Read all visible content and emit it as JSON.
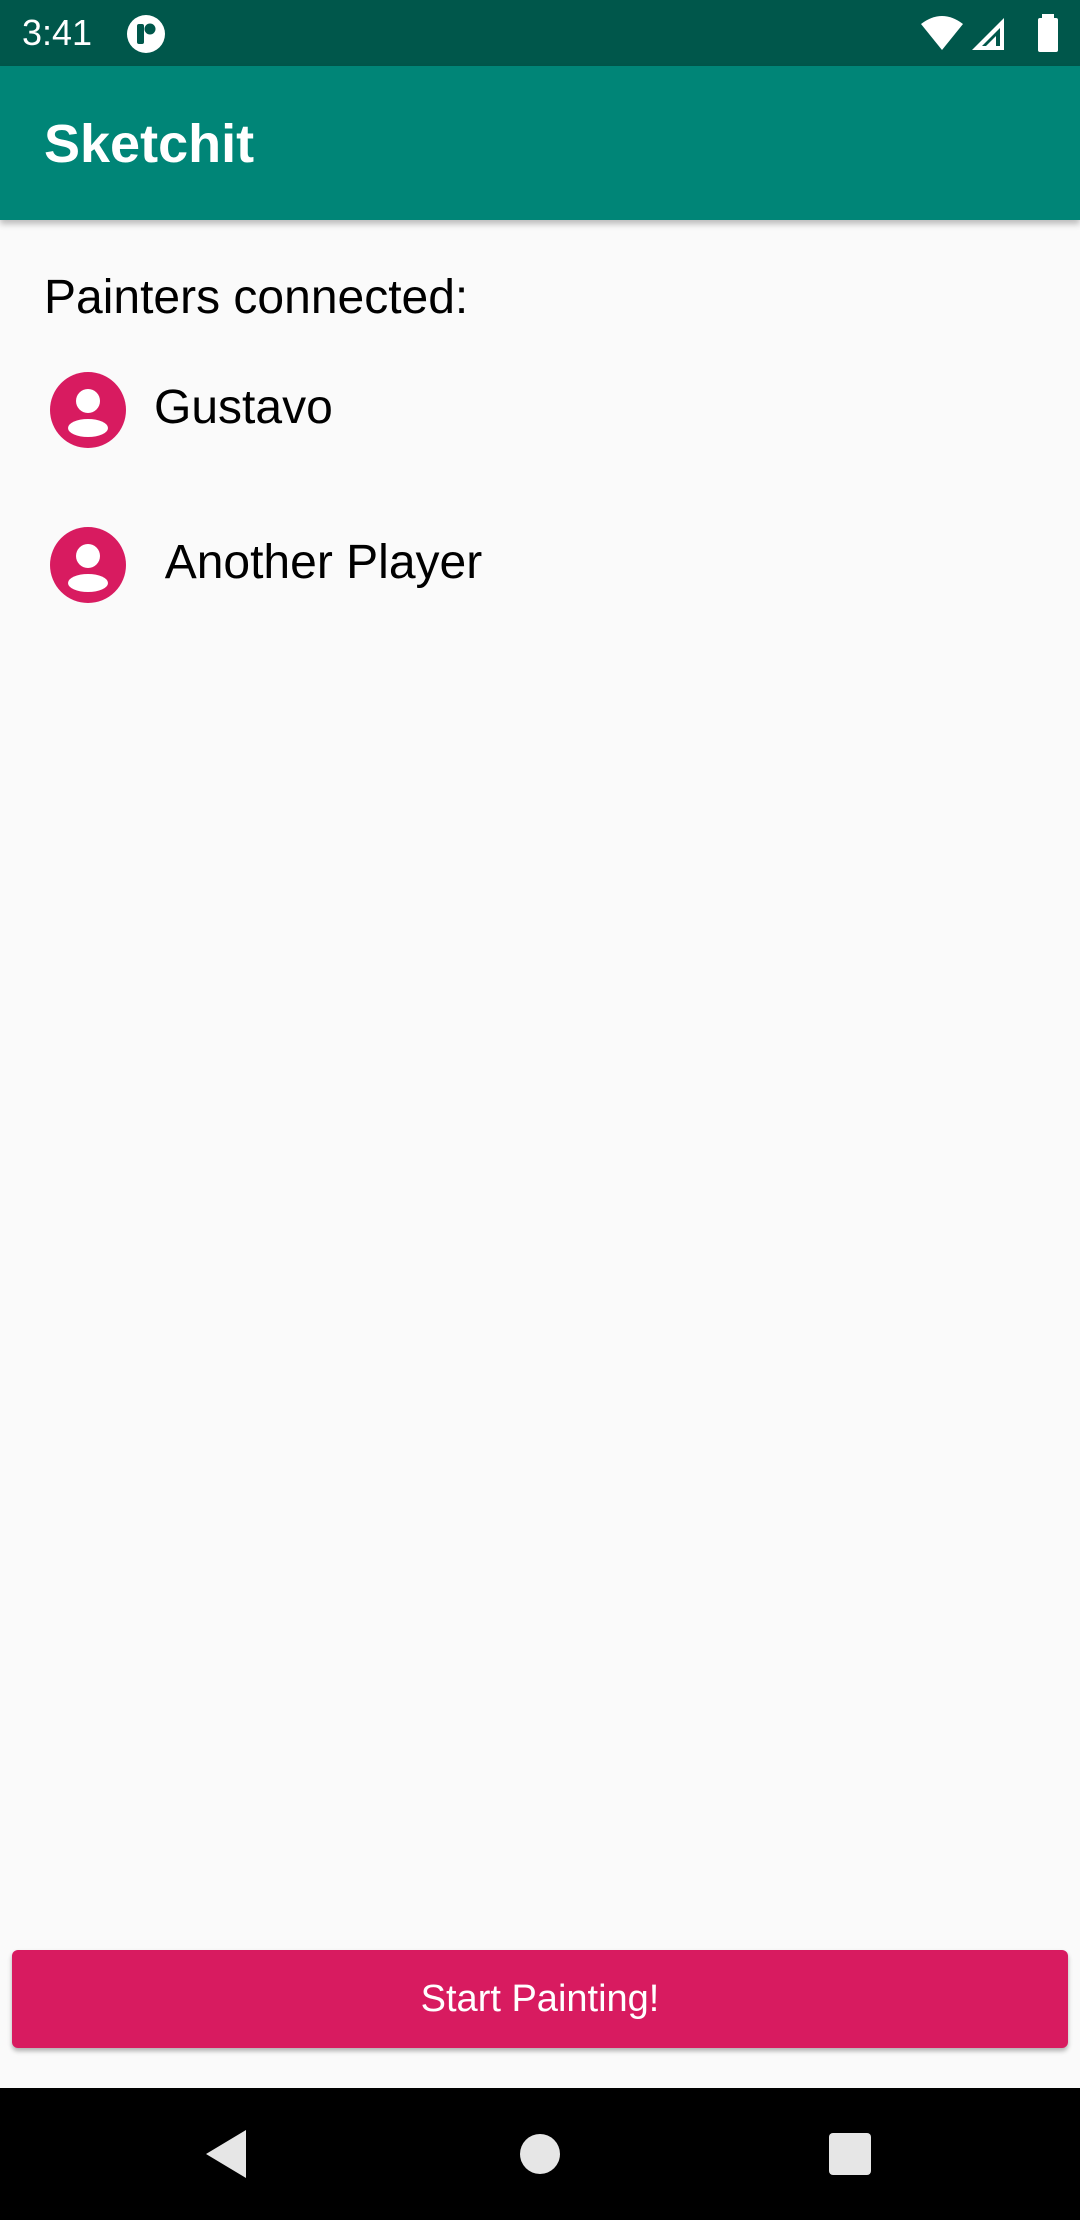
{
  "status_bar": {
    "time": "3:41",
    "app_icon": "app-notification-icon",
    "icons": [
      "wifi-icon",
      "cell-signal-icon",
      "battery-icon"
    ]
  },
  "app_bar": {
    "title": "Sketchit"
  },
  "main": {
    "section_label": "Painters connected:",
    "painters": [
      {
        "name": "Gustavo",
        "icon": "account-circle-icon"
      },
      {
        "name": " Another Player",
        "icon": "account-circle-icon"
      }
    ]
  },
  "start_button": {
    "label": "Start Painting!"
  },
  "nav_bar": {
    "buttons": [
      "back-icon",
      "home-icon",
      "recents-icon"
    ]
  },
  "colors": {
    "status_bar": "#00574b",
    "app_bar": "#008577",
    "accent": "#d81b60",
    "background": "#fafafa"
  }
}
